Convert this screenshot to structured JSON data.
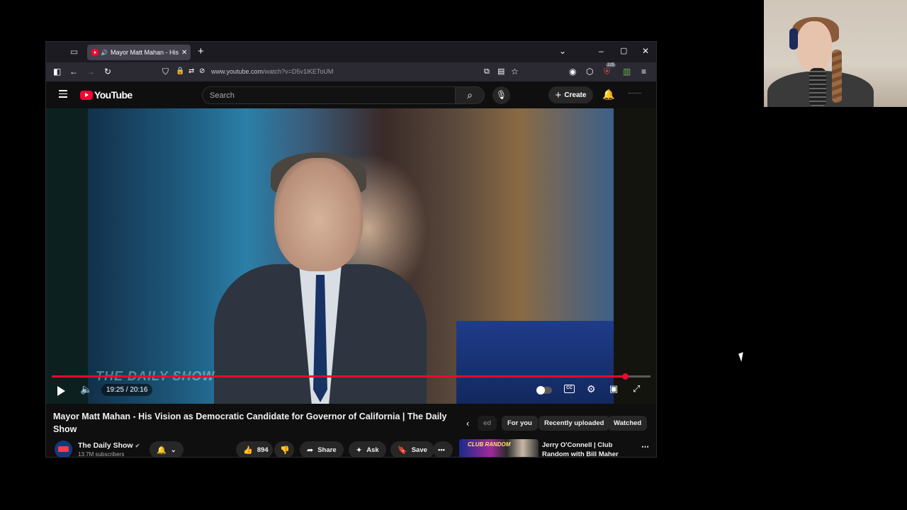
{
  "browser": {
    "tab_title": "Mayor Matt Mahan - His Vi",
    "url_host": "www.youtube.com",
    "url_path": "/watch?v=D5v1lKEToUM",
    "ext_badge": "225"
  },
  "yt": {
    "logo_text": "YouTube",
    "search_placeholder": "Search",
    "create_label": "Create"
  },
  "player": {
    "time_display": "19:25 / 20:16",
    "progress_fraction": 0.957,
    "watermark": "THE DAILY SHOW",
    "cc_label": "CC"
  },
  "video": {
    "title": "Mayor Matt Mahan - His Vision as Democratic Candidate for Governor of California | The Daily Show",
    "channel_name": "The Daily Show",
    "subscribers": "13.7M subscribers",
    "likes": "894",
    "share_label": "Share",
    "ask_label": "Ask",
    "save_label": "Save"
  },
  "chips": [
    "ed",
    "For you",
    "Recently uploaded",
    "Watched"
  ],
  "recommendation": {
    "title": "Jerry O'Connell | Club Random with Bill Maher",
    "thumb_text": "CLUB RANDOM"
  },
  "colors": {
    "accent": "#ff0033",
    "background": "#0f0f0f"
  }
}
